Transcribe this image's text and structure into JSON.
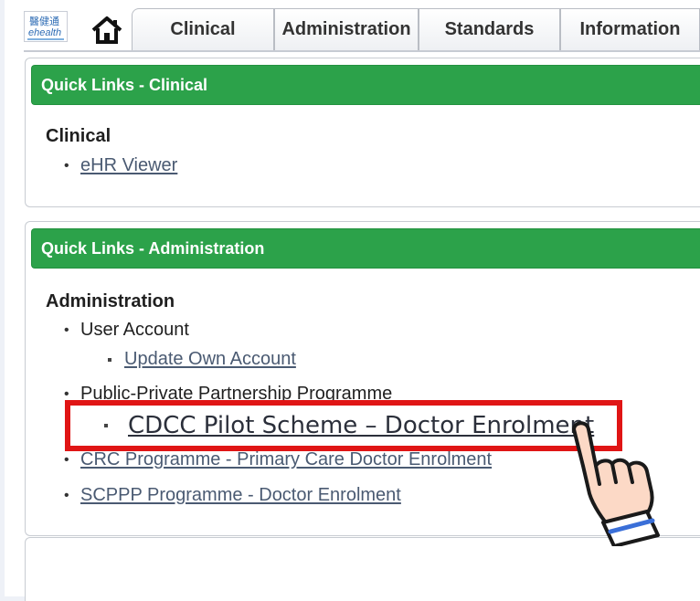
{
  "logo": {
    "cn": "醫健通",
    "en": "ehealth"
  },
  "tabs": {
    "clinical": "Clinical",
    "administration": "Administration",
    "standards": "Standards",
    "information": "Information"
  },
  "clinical_panel": {
    "header": "Quick Links - Clinical",
    "section_title": "Clinical",
    "links": [
      "eHR Viewer"
    ]
  },
  "admin_panel": {
    "header": "Quick Links - Administration",
    "section_title": "Administration",
    "user_account": {
      "label": "User Account",
      "links": [
        "Update Own Account"
      ]
    },
    "ppp": {
      "label": "Public-Private Partnership Programme",
      "highlighted_link": "CDCC Pilot Scheme – Doctor Enrolment"
    },
    "other_links": [
      "CRC Programme - Primary Care Doctor Enrolment",
      "SCPPP Programme - Doctor Enrolment"
    ]
  },
  "colors": {
    "header_green": "#2ca24a",
    "highlight_red": "#e01515",
    "link": "#4a5a72"
  },
  "icons": [
    "home-icon",
    "pointing-hand-icon"
  ]
}
